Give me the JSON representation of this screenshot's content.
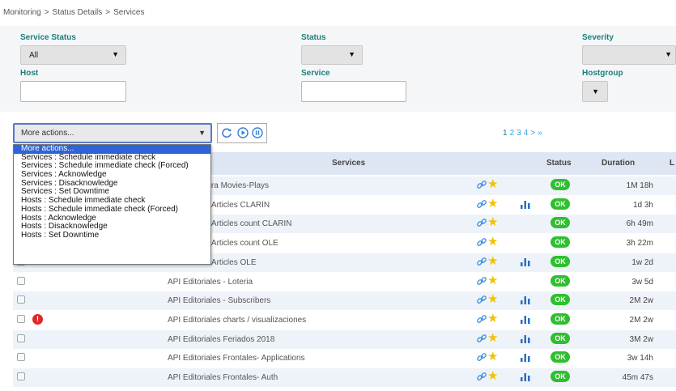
{
  "breadcrumb": {
    "items": [
      "Monitoring",
      "Status Details",
      "Services"
    ],
    "separator": ">"
  },
  "filters": {
    "service_status": {
      "label": "Service Status",
      "value": "All"
    },
    "status": {
      "label": "Status",
      "value": ""
    },
    "severity": {
      "label": "Severity",
      "value": ""
    },
    "host": {
      "label": "Host",
      "value": ""
    },
    "service": {
      "label": "Service",
      "value": ""
    },
    "hostgroup": {
      "label": "Hostgroup",
      "value": ""
    }
  },
  "actions": {
    "selected": "More actions...",
    "options": [
      "More actions...",
      "Services : Schedule immediate check",
      "Services : Schedule immediate check (Forced)",
      "Services : Acknowledge",
      "Services : Disacknowledge",
      "Services : Set Downtime",
      "Hosts : Schedule immediate check",
      "Hosts : Schedule immediate check (Forced)",
      "Hosts : Acknowledge",
      "Hosts : Disacknowledge",
      "Hosts : Set Downtime"
    ]
  },
  "controls": {
    "refresh_icon": "refresh-icon",
    "play_icon": "play-icon",
    "pause_icon": "pause-icon"
  },
  "pagination": {
    "pages": [
      "1",
      "2",
      "3",
      "4"
    ],
    "next": ">",
    "last": "»",
    "current": "1"
  },
  "table": {
    "columns": {
      "services": "Services",
      "status": "Status",
      "duration": "Duration",
      "last": "L"
    },
    "rows": [
      {
        "service": "les - Cartelera Movies-Plays",
        "graph": false,
        "status": "OK",
        "duration": "1M 18h",
        "alert": false
      },
      {
        "service": "les - Instant Articles CLARIN",
        "graph": true,
        "status": "OK",
        "duration": "1d 3h",
        "alert": false
      },
      {
        "service": "les - Instant Articles count CLARIN",
        "graph": false,
        "status": "OK",
        "duration": "6h 49m",
        "alert": false
      },
      {
        "service": "les - Instant Articles count OLE",
        "graph": false,
        "status": "OK",
        "duration": "3h 22m",
        "alert": false
      },
      {
        "service": "les - Instant Articles OLE",
        "graph": true,
        "status": "OK",
        "duration": "1w 2d",
        "alert": false
      },
      {
        "service": "API Editoriales - Loteria",
        "graph": false,
        "status": "OK",
        "duration": "3w 5d",
        "alert": false
      },
      {
        "service": "API Editoriales - Subscribers",
        "graph": true,
        "status": "OK",
        "duration": "2M 2w",
        "alert": false
      },
      {
        "service": "API Editoriales charts / visualizaciones",
        "graph": true,
        "status": "OK",
        "duration": "2M 2w",
        "alert": true
      },
      {
        "service": "API Editoriales Feriados 2018",
        "graph": true,
        "status": "OK",
        "duration": "3M 2w",
        "alert": false
      },
      {
        "service": "API Editoriales Frontales- Applications",
        "graph": true,
        "status": "OK",
        "duration": "3w 14h",
        "alert": false
      },
      {
        "service": "API Editoriales Frontales- Auth",
        "graph": true,
        "status": "OK",
        "duration": "45m 47s",
        "alert": false
      }
    ]
  },
  "colors": {
    "accent": "#1a7f7a",
    "ok": "#2fbf2f",
    "header": "#dde6f2",
    "selected": "#2f63d8",
    "star": "#f2c200",
    "link": "#3aa0e0"
  }
}
